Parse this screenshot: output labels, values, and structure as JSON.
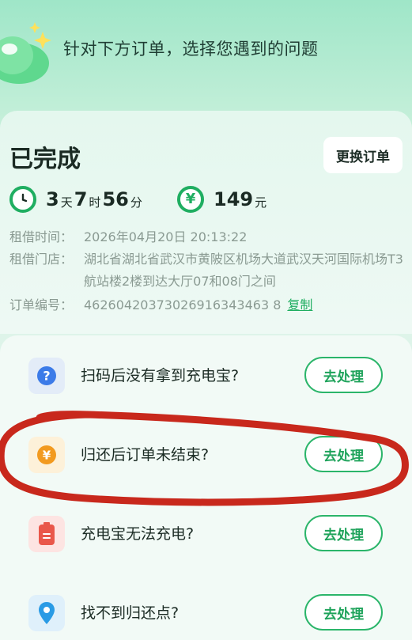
{
  "header": {
    "prompt": "针对下方订单，选择您遇到的问题",
    "mascot_icon": "green-cloud-mascot-icon"
  },
  "order": {
    "status": "已完成",
    "switch_button": "更换订单",
    "duration": {
      "days": "3",
      "days_unit": "天",
      "hours": "7",
      "hours_unit": "时",
      "minutes": "56",
      "minutes_unit": "分",
      "icon": "clock-icon"
    },
    "fee": {
      "amount": "149",
      "unit": "元",
      "icon": "yuan-icon"
    },
    "rent_time_label": "租借时间：",
    "rent_time_value": "2026年04月20日 20:13:22",
    "store_label": "租借门店：",
    "store_value": "湖北省湖北省武汉市黄陂区机场大道武汉天河国际机场T3航站楼2楼到达大厅07和08门之间",
    "order_no_label": "订单编号：",
    "order_no_value": "46260420373026916343463 8",
    "copy_label": "复制"
  },
  "problems": [
    {
      "text": "扫码后没有拿到充电宝?",
      "button": "去处理",
      "icon": "question-icon",
      "icon_bg": "#e3ecf8",
      "icon_color": "#3c7be8"
    },
    {
      "text": "归还后订单未结束?",
      "button": "去处理",
      "icon": "yuan-coin-icon",
      "icon_bg": "#fdf1d9",
      "icon_color": "#f29a1f"
    },
    {
      "text": "充电宝无法充电?",
      "button": "去处理",
      "icon": "battery-icon",
      "icon_bg": "#fde4e2",
      "icon_color": "#e9574a"
    },
    {
      "text": "找不到归还点?",
      "button": "去处理",
      "icon": "location-pin-icon",
      "icon_bg": "#dff0fb",
      "icon_color": "#2a9be5"
    }
  ],
  "colors": {
    "accent": "#1fae61",
    "annotation": "#c8281c"
  }
}
